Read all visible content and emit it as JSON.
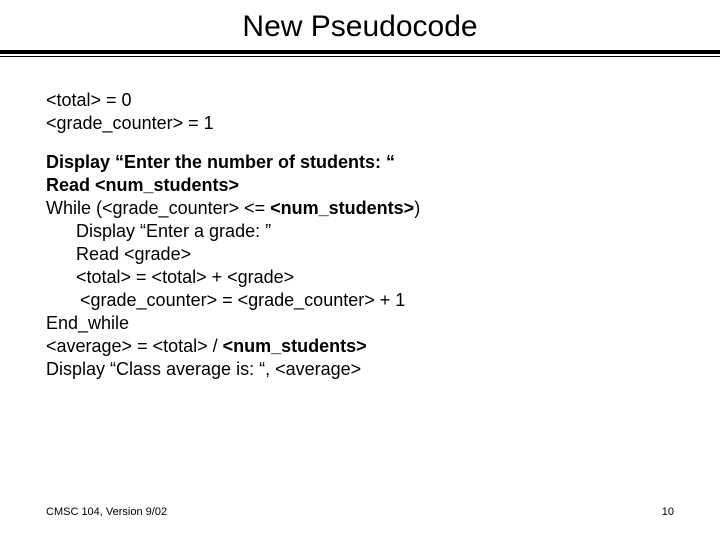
{
  "title": "New Pseudocode",
  "init": {
    "l1": "<total> = 0",
    "l2": "<grade_counter> = 1"
  },
  "body": {
    "l1": "Display “Enter the number of students: “",
    "l2": "Read <num_students>",
    "l3_pre": "While  (<grade_counter>  <=  ",
    "l3_b": "<num_students>",
    "l3_post": ")",
    "l4": "Display “Enter a grade: ”",
    "l5": "Read <grade>",
    "l6": "<total> = <total> + <grade>",
    "l7": "<grade_counter> = <grade_counter> + 1",
    "l8": "End_while",
    "l9_pre": "<average> = <total> / ",
    "l9_b": "<num_students>",
    "l10": "Display “Class average is: “, <average>"
  },
  "footer": {
    "course": "CMSC 104, Version 9/02",
    "page": "10"
  }
}
